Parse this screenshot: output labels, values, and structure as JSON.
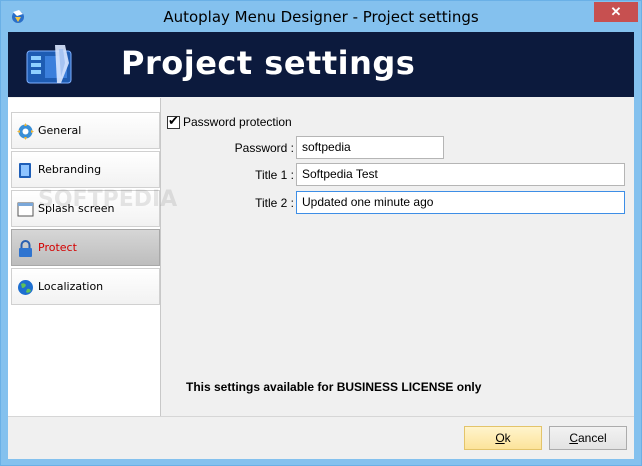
{
  "window": {
    "title": "Autoplay Menu Designer - Project settings",
    "close_glyph": "✕",
    "accent": "#84c1ee"
  },
  "banner": {
    "title": "Project settings",
    "background": "#0c1a3d"
  },
  "sidebar": {
    "items": [
      {
        "label": "General",
        "icon": "gear-icon",
        "active": false
      },
      {
        "label": "Rebranding",
        "icon": "book-icon",
        "active": false
      },
      {
        "label": "Splash screen",
        "icon": "window-icon",
        "active": false
      },
      {
        "label": "Protect",
        "icon": "lock-icon",
        "active": true
      },
      {
        "label": "Localization",
        "icon": "globe-icon",
        "active": false
      }
    ]
  },
  "protect": {
    "password_protection_label": "Password protection",
    "password_protection_checked": true,
    "password_label": "Password :",
    "password_value": "softpedia",
    "title1_label": "Title 1 :",
    "title1_value": "Softpedia Test",
    "title2_label": "Title 2 :",
    "title2_value": "Updated one minute ago",
    "notice": "This settings available for BUSINESS LICENSE only"
  },
  "buttons": {
    "ok": {
      "mnemonic": "O",
      "rest": "k"
    },
    "cancel": {
      "mnemonic": "C",
      "rest": "ancel"
    }
  },
  "watermark": "SOFTPEDIA"
}
